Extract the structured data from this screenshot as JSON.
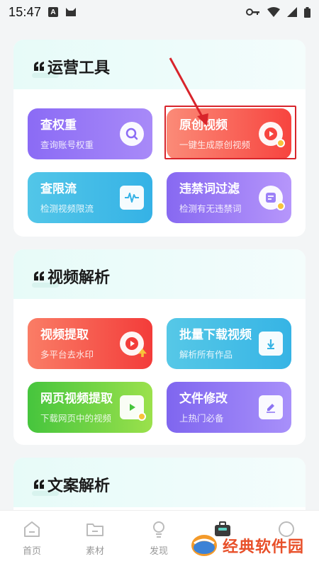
{
  "status_bar": {
    "time": "15:47",
    "app_icon_letter": "A"
  },
  "sections": [
    {
      "title": "运营工具"
    },
    {
      "title": "视频解析"
    },
    {
      "title": "文案解析"
    }
  ],
  "cards": [
    {
      "title": "查权重",
      "subtitle": "查询账号权重",
      "icon": "search-icon"
    },
    {
      "title": "原创视频",
      "subtitle": "一键生成原创视频",
      "icon": "play-icon"
    },
    {
      "title": "查限流",
      "subtitle": "检测视频限流",
      "icon": "waveform-icon"
    },
    {
      "title": "违禁词过滤",
      "subtitle": "检测有无违禁词",
      "icon": "document-filter-icon"
    },
    {
      "title": "视频提取",
      "subtitle": "多平台去水印",
      "icon": "play-upload-icon"
    },
    {
      "title": "批量下载视频",
      "subtitle": "解析所有作品",
      "icon": "download-icon"
    },
    {
      "title": "网页视频提取",
      "subtitle": "下载网页中的视频",
      "icon": "video-file-icon"
    },
    {
      "title": "文件修改",
      "subtitle": "上热门必备",
      "icon": "edit-file-icon"
    }
  ],
  "bottom_nav": [
    {
      "label": "首页",
      "icon": "home-icon"
    },
    {
      "label": "素材",
      "icon": "folder-icon"
    },
    {
      "label": "发现",
      "icon": "lightbulb-icon"
    },
    {
      "label": "",
      "icon": "toolbox-icon"
    },
    {
      "label": "",
      "icon": "profile-icon"
    }
  ],
  "watermark": {
    "text": "经典软件园"
  },
  "colors": {
    "highlight": "#d8242b",
    "accent_red": "#f33c3a",
    "section_header_bg": "#e7fbf8"
  }
}
